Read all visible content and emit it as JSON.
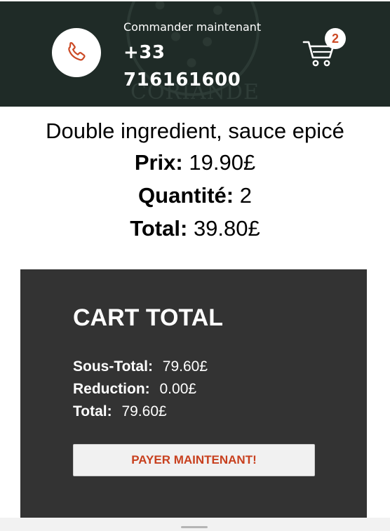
{
  "header": {
    "order_label": "Commander maintenant",
    "phone": "+33 716161600",
    "cart_count": "2",
    "logo_text": "CORIANDE"
  },
  "product": {
    "name": "Double ingredient, sauce epicé",
    "price_label": "Prix:",
    "price_value": "19.90£",
    "quantity_label": "Quantité:",
    "quantity_value": "2",
    "total_label": "Total:",
    "total_value": "39.80£"
  },
  "cart_total": {
    "title": "CART TOTAL",
    "subtotal_label": "Sous-Total:",
    "subtotal_value": "79.60£",
    "reduction_label": "Reduction:",
    "reduction_value": "0.00£",
    "total_label": "Total:",
    "total_value": "79.60£",
    "pay_button": "PAYER MAINTENANT!"
  },
  "icons": {
    "phone": "phone-icon",
    "cart": "cart-icon"
  },
  "colors": {
    "header_bg": "#1f2b27",
    "accent": "#cc4a25",
    "panel_bg": "#333333"
  }
}
